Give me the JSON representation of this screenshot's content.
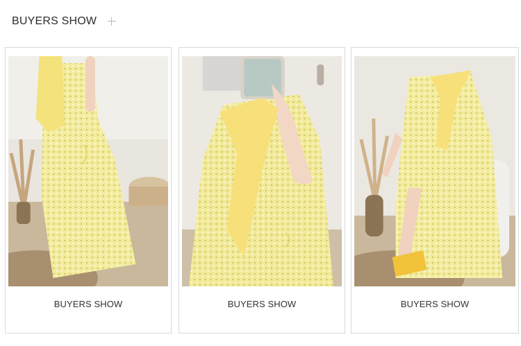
{
  "header": {
    "title": "BUYERS SHOW",
    "add_icon": "plus-icon"
  },
  "cards": [
    {
      "caption": "BUYERS SHOW",
      "image": "photo-back-view-yellow-floral-dress"
    },
    {
      "caption": "BUYERS SHOW",
      "image": "photo-front-closeup-yellow-floral-dress"
    },
    {
      "caption": "BUYERS SHOW",
      "image": "photo-seated-yellow-floral-dress"
    }
  ],
  "colors": {
    "dress": "#f3e98f",
    "scarf": "#f6e07a",
    "floor": "#a88f6f",
    "wall": "#ece9e3"
  }
}
